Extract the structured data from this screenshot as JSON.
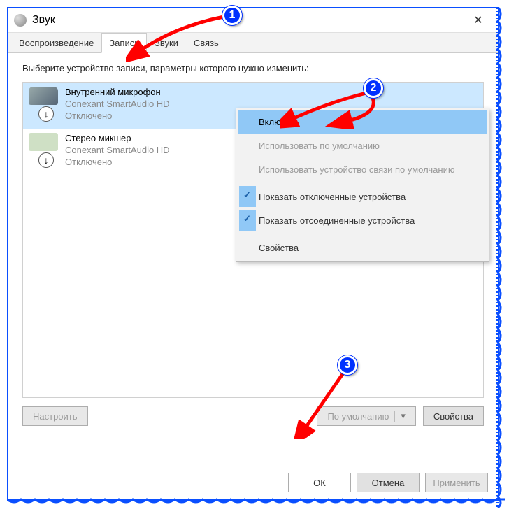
{
  "window": {
    "title": "Звук"
  },
  "tabs": {
    "playback": "Воспроизведение",
    "recording": "Запись",
    "sounds": "Звуки",
    "comm": "Связь"
  },
  "instruction": "Выберите устройство записи, параметры которого нужно изменить:",
  "devices": [
    {
      "name": "Внутренний микрофон",
      "sub": "Conexant SmartAudio HD",
      "status": "Отключено"
    },
    {
      "name": "Стерео микшер",
      "sub": "Conexant SmartAudio HD",
      "status": "Отключено"
    }
  ],
  "context_menu": {
    "enable": "Включить",
    "set_default": "Использовать по умолчанию",
    "set_comm": "Использовать устройство связи по умолчанию",
    "show_disabled": "Показать отключенные устройства",
    "show_disconnected": "Показать отсоединенные устройства",
    "properties": "Свойства"
  },
  "buttons": {
    "configure": "Настроить",
    "default": "По умолчанию",
    "properties": "Свойства",
    "ok": "ОК",
    "cancel": "Отмена",
    "apply": "Применить"
  },
  "annotations": {
    "b1": "1",
    "b2": "2",
    "b3": "3"
  }
}
